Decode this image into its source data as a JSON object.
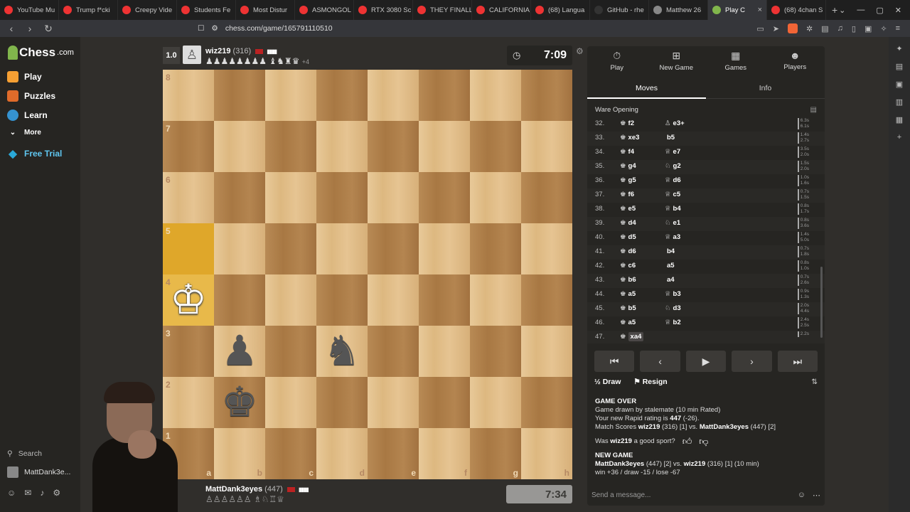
{
  "browser": {
    "tabs": [
      {
        "title": "YouTube Mu",
        "fav": "#e33"
      },
      {
        "title": "Trump f*cki",
        "fav": "#e33"
      },
      {
        "title": "Creepy Vide",
        "fav": "#e33"
      },
      {
        "title": "Students Fe",
        "fav": "#e33"
      },
      {
        "title": "Most Distur",
        "fav": "#e33"
      },
      {
        "title": "ASMONGOL",
        "fav": "#e33"
      },
      {
        "title": "RTX 3080 Sc",
        "fav": "#e33"
      },
      {
        "title": "THEY FINALL",
        "fav": "#e33"
      },
      {
        "title": "CALIFORNIA",
        "fav": "#e33"
      },
      {
        "title": "(68) Langua",
        "fav": "#e33"
      },
      {
        "title": "GitHub - rhe",
        "fav": "#333"
      },
      {
        "title": "Matthew 26",
        "fav": "#888"
      },
      {
        "title": "Play C",
        "fav": "#81b64c",
        "active": true
      },
      {
        "title": "(68) 4chan S",
        "fav": "#e33"
      }
    ],
    "url": "chess.com/game/165791110510",
    "new_tab": "+"
  },
  "nav": {
    "logo": "Chess",
    "logo_suffix": ".com",
    "items": [
      {
        "label": "Play",
        "color": "#f6a033"
      },
      {
        "label": "Puzzles",
        "color": "#e06b2a"
      },
      {
        "label": "Learn",
        "color": "#3592d0"
      },
      {
        "label": "More",
        "color": ""
      },
      {
        "label": "Free Trial",
        "color": "#2aa8d8"
      }
    ],
    "search": "Search",
    "username": "MattDank3e..."
  },
  "top_player": {
    "score": "1.0",
    "name": "wiz219",
    "rating": "(316)",
    "captured": "♟♟♟♟♟♟♟♟ ♝♞♜♛",
    "advantage": "+4",
    "clock": "7:09"
  },
  "bottom_player": {
    "name": "MattDank3eyes",
    "rating": "(447)",
    "captured": "♙♙♙♙♙♙ ♗♘♖♕",
    "clock": "7:34"
  },
  "board": {
    "files": [
      "a",
      "b",
      "c",
      "d",
      "e",
      "f",
      "g",
      "h"
    ],
    "ranks": [
      "8",
      "7",
      "6",
      "5",
      "4",
      "3",
      "2",
      "1"
    ],
    "pieces": [
      {
        "square": "a4",
        "glyph": "♔",
        "color": "w"
      },
      {
        "square": "b3",
        "glyph": "♟",
        "color": "b"
      },
      {
        "square": "d3",
        "glyph": "♞",
        "color": "b"
      },
      {
        "square": "b2",
        "glyph": "♚",
        "color": "b"
      }
    ],
    "highlights": [
      "a5",
      "a4"
    ]
  },
  "panel": {
    "tabs": [
      "Play",
      "New Game",
      "Games",
      "Players"
    ],
    "subtabs": [
      "Moves",
      "Info"
    ],
    "opening": "Ware Opening",
    "moves": [
      {
        "n": "32.",
        "w": "f2",
        "b": "e3+",
        "bp": "♙",
        "t1": "6.3s",
        "t2": "6.1s"
      },
      {
        "n": "33.",
        "w": "xe3",
        "b": "b5",
        "bp": "",
        "t1": "1.4s",
        "t2": "2.7s"
      },
      {
        "n": "34.",
        "w": "f4",
        "b": "e7",
        "bp": "♕",
        "t1": "3.5s",
        "t2": "2.0s"
      },
      {
        "n": "35.",
        "w": "g4",
        "b": "g2",
        "bp": "♘",
        "t1": "1.5s",
        "t2": "2.0s"
      },
      {
        "n": "36.",
        "w": "g5",
        "b": "d6",
        "bp": "♕",
        "t1": "1.0s",
        "t2": "1.6s"
      },
      {
        "n": "37.",
        "w": "f6",
        "b": "c5",
        "bp": "♕",
        "t1": "0.7s",
        "t2": "1.5s"
      },
      {
        "n": "38.",
        "w": "e5",
        "b": "b4",
        "bp": "♕",
        "t1": "0.8s",
        "t2": "1.7s"
      },
      {
        "n": "39.",
        "w": "d4",
        "b": "e1",
        "bp": "♘",
        "t1": "0.8s",
        "t2": "3.6s"
      },
      {
        "n": "40.",
        "w": "d5",
        "b": "a3",
        "bp": "♕",
        "t1": "1.4s",
        "t2": "5.0s"
      },
      {
        "n": "41.",
        "w": "d6",
        "b": "b4",
        "bp": "",
        "t1": "0.7s",
        "t2": "1.8s"
      },
      {
        "n": "42.",
        "w": "c6",
        "b": "a5",
        "bp": "",
        "t1": "0.8s",
        "t2": "1.0s"
      },
      {
        "n": "43.",
        "w": "b6",
        "b": "a4",
        "bp": "",
        "t1": "0.7s",
        "t2": "2.6s"
      },
      {
        "n": "44.",
        "w": "a5",
        "b": "b3",
        "bp": "♕",
        "t1": "0.9s",
        "t2": "1.3s"
      },
      {
        "n": "45.",
        "w": "b5",
        "b": "d3",
        "bp": "♘",
        "t1": "2.0s",
        "t2": "4.4s"
      },
      {
        "n": "46.",
        "w": "a5",
        "b": "b2",
        "bp": "♕",
        "t1": "2.4s",
        "t2": "2.5s"
      },
      {
        "n": "47.",
        "w": "xa4",
        "b": "",
        "bp": "",
        "t1": "2.2s",
        "t2": "",
        "current": true
      }
    ],
    "controls": [
      "⏮",
      "‹",
      "▶",
      "›",
      "⏭"
    ],
    "draw": "Draw",
    "draw_icon": "½",
    "resign": "Resign",
    "game_over": {
      "heading": "GAME OVER",
      "line1": "Game drawn by stalemate (10 min Rated)",
      "rating_prefix": "Your new Rapid rating is",
      "rating_value": "447",
      "rating_delta": "(-26).",
      "match_prefix": "Match Scores",
      "p1": "wiz219",
      "p1_rest": "(316) [1] vs.",
      "p2": "MattDank3eyes",
      "p2_rest": "(447) [2]",
      "sport_prefix": "Was",
      "sport_name": "wiz219",
      "sport_suffix": "a good sport?"
    },
    "new_game": {
      "heading": "NEW GAME",
      "p1": "MattDank3eyes",
      "p1_rest": "(447) [2] vs.",
      "p2": "wiz219",
      "p2_rest": "(316) [1] (10 min)",
      "line2": "win +36 / draw -15 / lose -67"
    },
    "chat_placeholder": "Send a message..."
  }
}
